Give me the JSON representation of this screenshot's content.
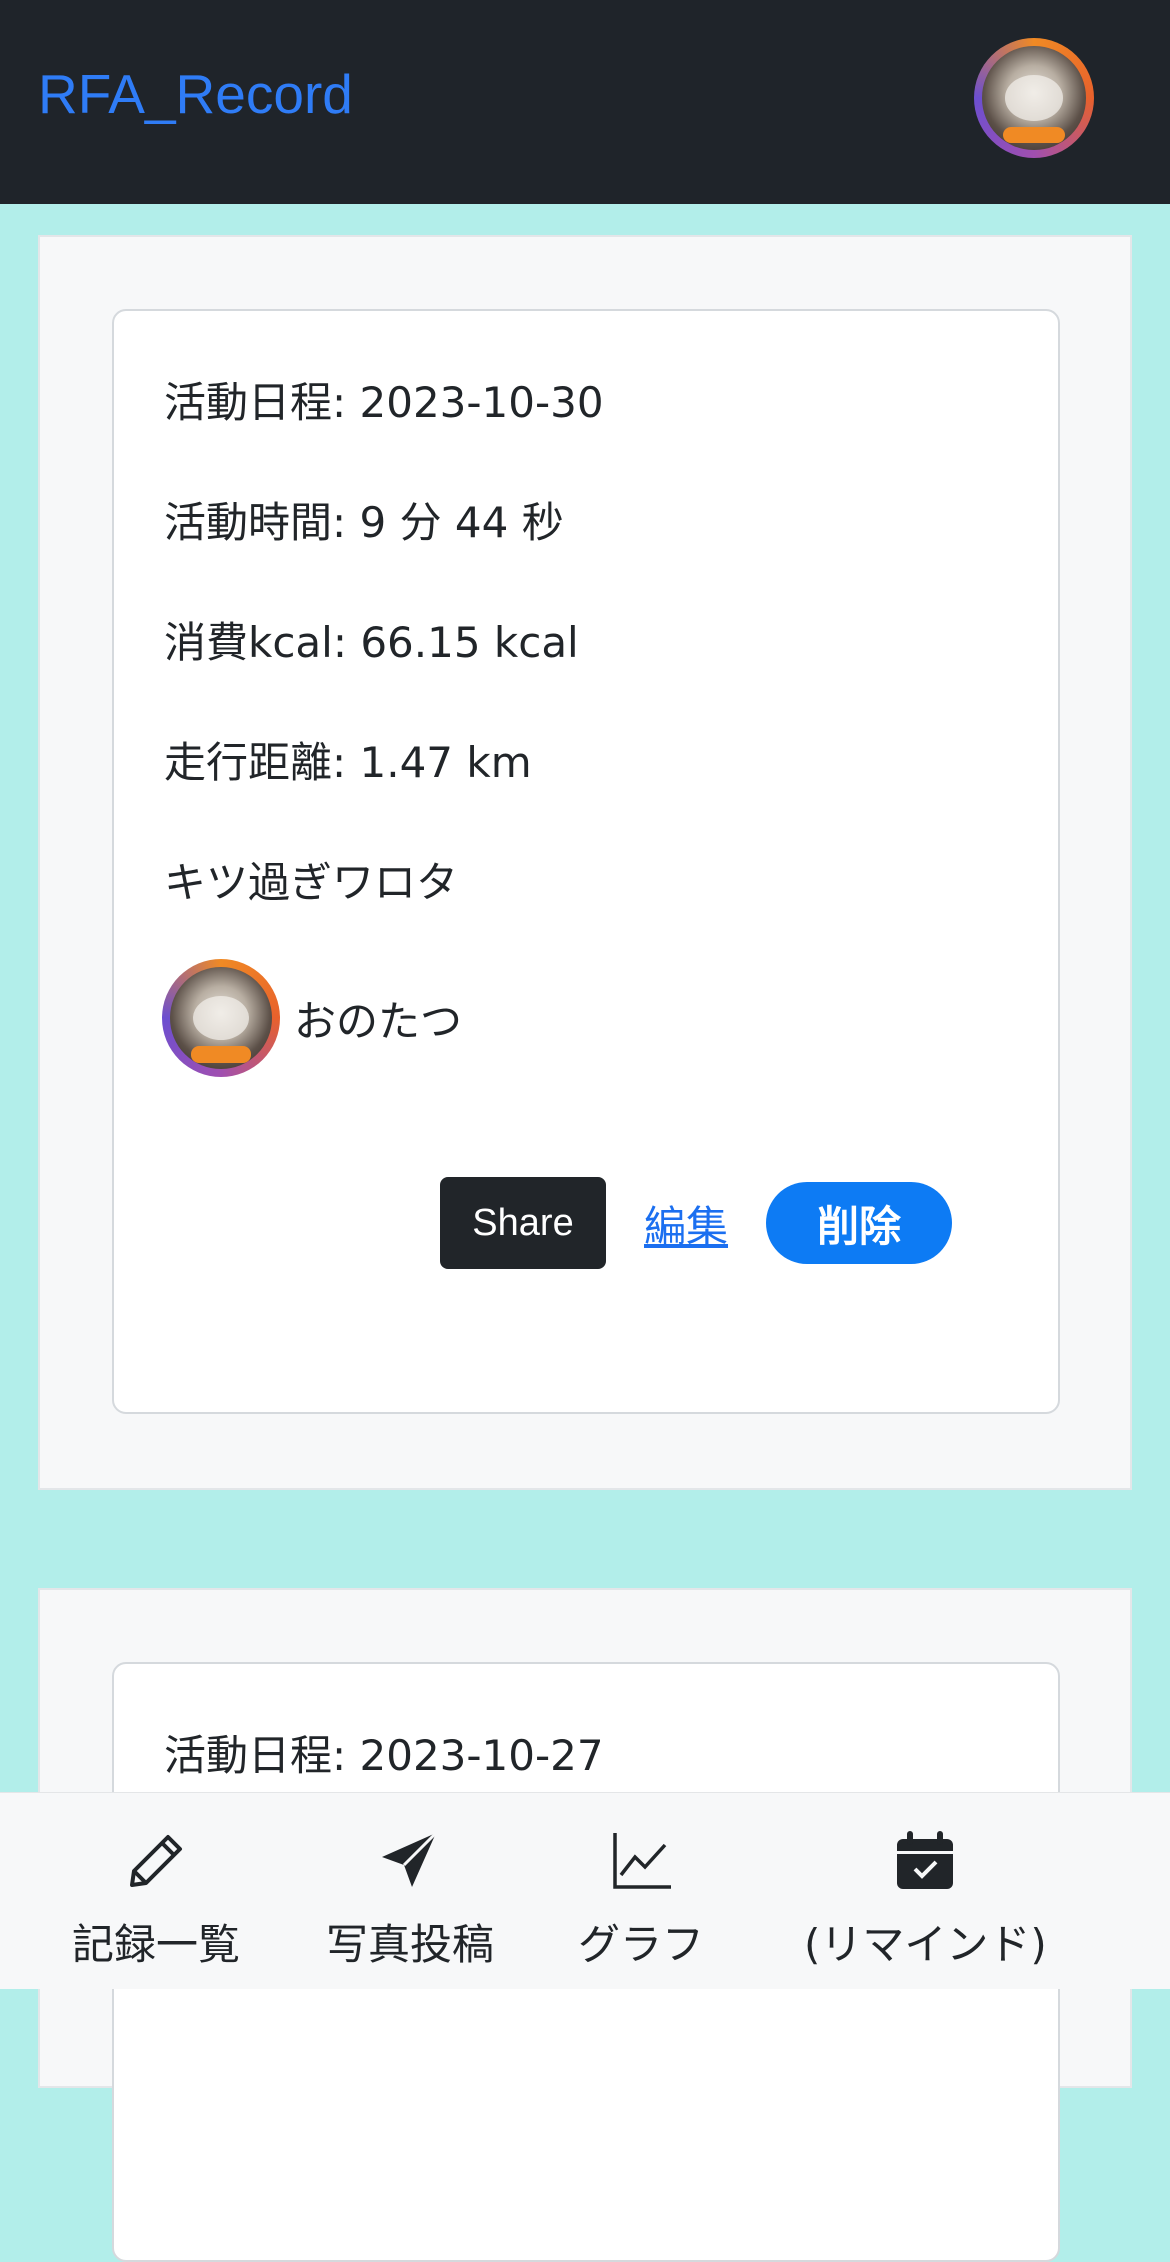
{
  "app": {
    "brand": "RFA_Record"
  },
  "records": [
    {
      "date_line": "活動日程: 2023-10-30",
      "duration_line": "活動時間: 9 分 44 秒",
      "kcal_line": "消費kcal: 66.15 kcal",
      "distance_line": "走行距離: 1.47 km",
      "comment": "キツ過ぎワロタ",
      "user_name": "おのたつ",
      "share_label": "Share",
      "edit_label": "編集",
      "delete_label": "削除"
    },
    {
      "date_line": "活動日程: 2023-10-27"
    }
  ],
  "bottom_nav": [
    {
      "label": "記録一覧",
      "icon": "pencil-icon"
    },
    {
      "label": "写真投稿",
      "icon": "send-icon"
    },
    {
      "label": "グラフ",
      "icon": "chart-line-icon"
    },
    {
      "label": "(リマインド)",
      "icon": "calendar-check-icon"
    }
  ],
  "colors": {
    "navbar_bg": "#1f242a",
    "brand": "#2f7cf6",
    "page_bg": "#b2eeea",
    "delete_button": "#0d7bf4",
    "share_button": "#212529"
  }
}
